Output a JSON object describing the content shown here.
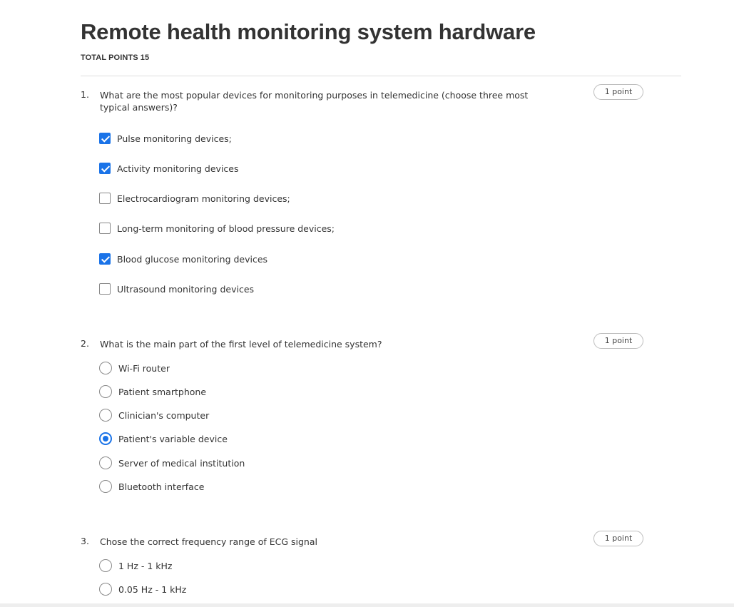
{
  "header": {
    "title": "Remote health monitoring system hardware",
    "total_points": "TOTAL POINTS 15"
  },
  "questions": [
    {
      "number": "1.",
      "text": "What are the most popular devices for monitoring purposes in telemedicine (choose three most typical answers)?",
      "points": "1 point",
      "type": "checkbox",
      "options": [
        {
          "label": "Pulse monitoring devices;",
          "selected": true
        },
        {
          "label": "Activity monitoring devices",
          "selected": true
        },
        {
          "label": "Electrocardiogram monitoring devices;",
          "selected": false
        },
        {
          "label": "Long-term monitoring of blood pressure devices;",
          "selected": false
        },
        {
          "label": "Blood glucose monitoring devices",
          "selected": true
        },
        {
          "label": "Ultrasound monitoring devices",
          "selected": false
        }
      ]
    },
    {
      "number": "2.",
      "text": "What is the main part of the first level of telemedicine system?",
      "points": "1 point",
      "type": "radio",
      "options": [
        {
          "label": "Wi-Fi router",
          "selected": false
        },
        {
          "label": "Patient smartphone",
          "selected": false
        },
        {
          "label": "Clinician's computer",
          "selected": false
        },
        {
          "label": "Patient's variable device",
          "selected": true
        },
        {
          "label": "Server of medical institution",
          "selected": false
        },
        {
          "label": "Bluetooth interface",
          "selected": false
        }
      ]
    },
    {
      "number": "3.",
      "text": "Chose the correct frequency range of ECG signal",
      "points": "1 point",
      "type": "radio",
      "options": [
        {
          "label": "1 Hz - 1 kHz",
          "selected": false
        },
        {
          "label": "0.05 Hz - 1 kHz",
          "selected": false
        }
      ]
    }
  ],
  "colors": {
    "accent": "#1a73e8",
    "text": "#333333",
    "border": "#8a8a8a",
    "divider": "#dddddd"
  }
}
